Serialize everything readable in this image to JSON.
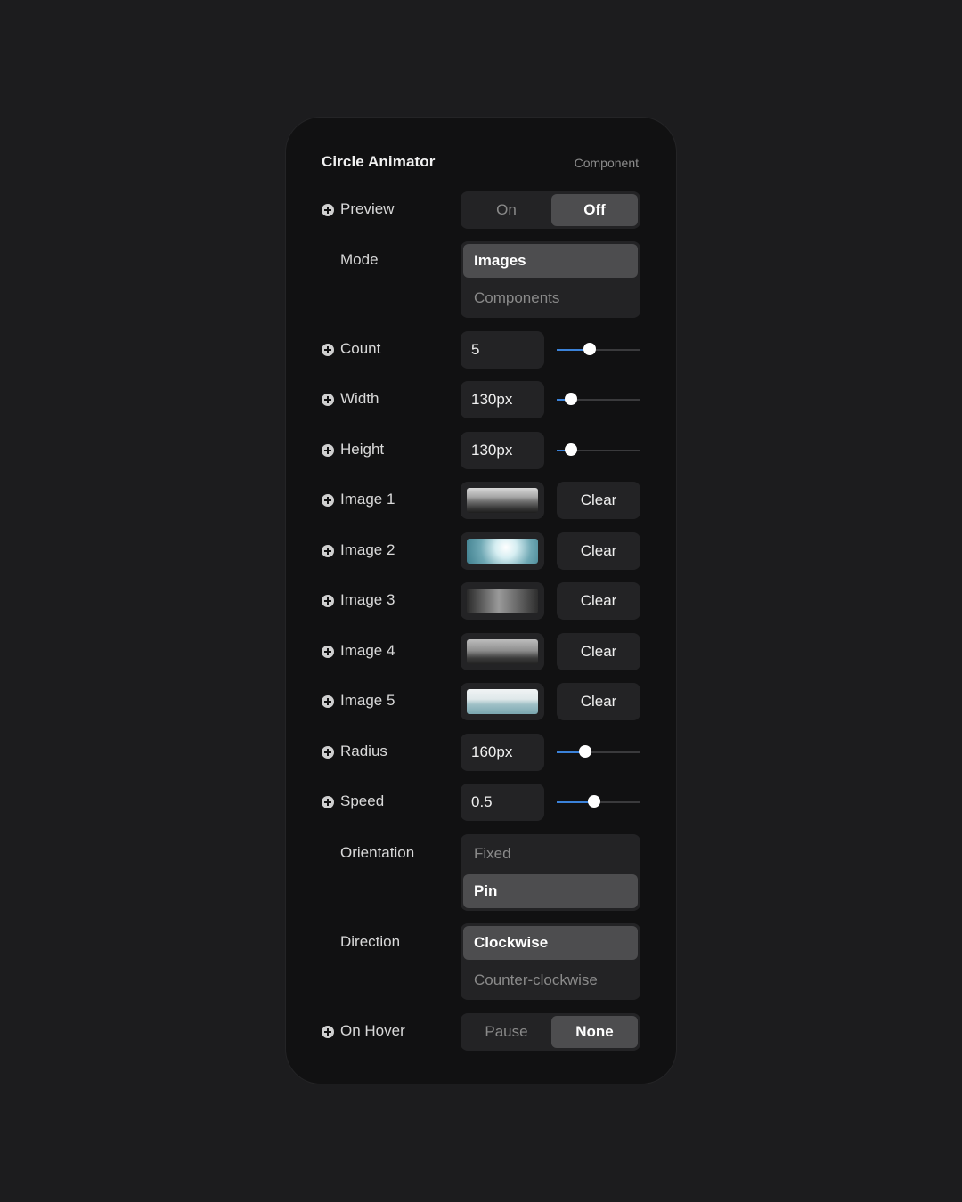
{
  "header": {
    "title": "Circle Animator",
    "subtitle": "Component"
  },
  "preview": {
    "label": "Preview",
    "options": [
      "On",
      "Off"
    ],
    "selected": "Off"
  },
  "mode": {
    "label": "Mode",
    "options": [
      "Images",
      "Components"
    ],
    "selected": "Images"
  },
  "count": {
    "label": "Count",
    "value": "5",
    "slider_fraction": 0.39
  },
  "width": {
    "label": "Width",
    "value": "130px",
    "slider_fraction": 0.17
  },
  "height": {
    "label": "Height",
    "value": "130px",
    "slider_fraction": 0.17
  },
  "images": [
    {
      "label": "Image 1",
      "button": "Clear"
    },
    {
      "label": "Image 2",
      "button": "Clear"
    },
    {
      "label": "Image 3",
      "button": "Clear"
    },
    {
      "label": "Image 4",
      "button": "Clear"
    },
    {
      "label": "Image 5",
      "button": "Clear"
    }
  ],
  "radius": {
    "label": "Radius",
    "value": "160px",
    "slider_fraction": 0.34
  },
  "speed": {
    "label": "Speed",
    "value": "0.5",
    "slider_fraction": 0.45
  },
  "orientation": {
    "label": "Orientation",
    "options": [
      "Fixed",
      "Pin"
    ],
    "selected": "Pin"
  },
  "direction": {
    "label": "Direction",
    "options": [
      "Clockwise",
      "Counter-clockwise"
    ],
    "selected": "Clockwise"
  },
  "on_hover": {
    "label": "On Hover",
    "options": [
      "Pause",
      "None"
    ],
    "selected": "None"
  },
  "colors": {
    "accent": "#3b82d9",
    "panel": "#111112",
    "background": "#1c1c1e",
    "control": "#232325",
    "active": "#4d4d4f"
  }
}
